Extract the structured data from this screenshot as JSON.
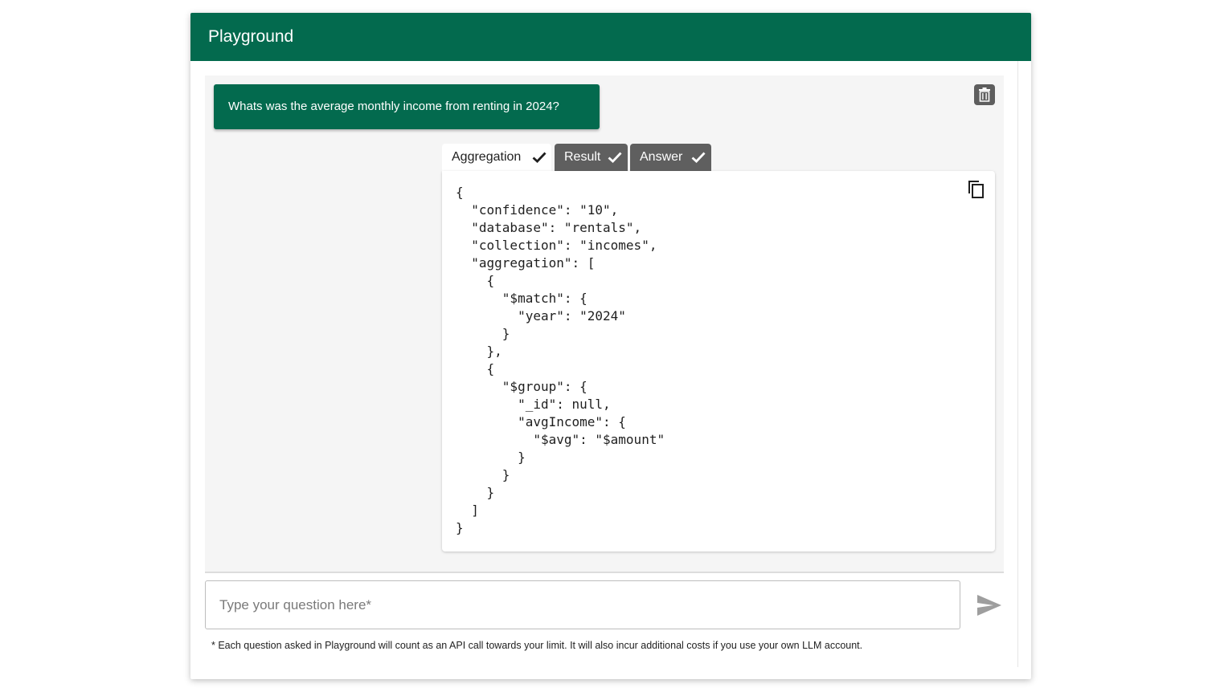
{
  "header": {
    "title": "Playground"
  },
  "chat": {
    "user_message": "Whats was the average monthly income from renting in 2024?",
    "tabs": [
      {
        "label": "Aggregation",
        "active": true,
        "done": true
      },
      {
        "label": "Result",
        "active": false,
        "done": true
      },
      {
        "label": "Answer",
        "active": false,
        "done": true
      }
    ],
    "code": "{\n  \"confidence\": \"10\",\n  \"database\": \"rentals\",\n  \"collection\": \"incomes\",\n  \"aggregation\": [\n    {\n      \"$match\": {\n        \"year\": \"2024\"\n      }\n    },\n    {\n      \"$group\": {\n        \"_id\": null,\n        \"avgIncome\": {\n          \"$avg\": \"$amount\"\n        }\n      }\n    }\n  ]\n}"
  },
  "input": {
    "placeholder": "Type your question here*",
    "value": ""
  },
  "footnote": "*  Each question asked in Playground will count as an API call towards your limit. It will also incur additional costs if you use your own LLM account.",
  "icons": {
    "trash": "trash-icon",
    "copy": "copy-icon",
    "send": "send-icon",
    "check": "check-icon"
  },
  "colors": {
    "brand": "#036a4e",
    "tab_inactive": "#5f5f5f",
    "panel_bg": "#f5f5f5"
  }
}
